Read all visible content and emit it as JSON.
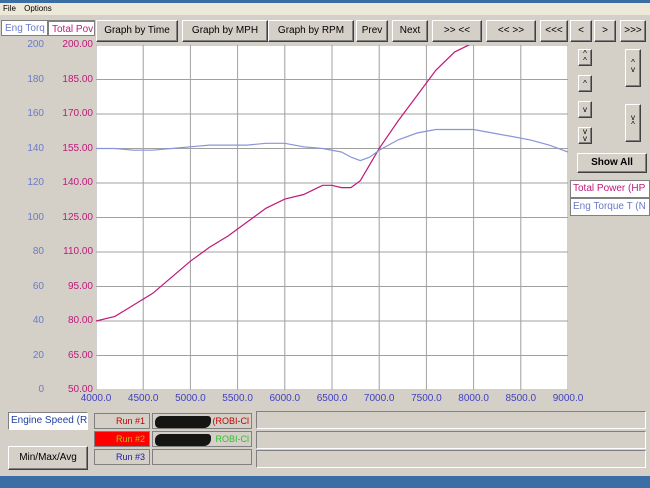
{
  "menu": {
    "file": "File",
    "options": "Options"
  },
  "axis_tabs": {
    "left": "Eng Torq",
    "right": "Total Pov"
  },
  "nav_buttons": [
    {
      "name": "graph-by-time-button",
      "label": "Graph by Time"
    },
    {
      "name": "graph-by-mph-button",
      "label": "Graph by MPH"
    },
    {
      "name": "graph-by-rpm-button",
      "label": "Graph by RPM"
    },
    {
      "name": "prev-button",
      "label": "Prev"
    },
    {
      "name": "next-button",
      "label": "Next"
    },
    {
      "name": "zoom-in-button",
      "label": ">> <<"
    },
    {
      "name": "zoom-out-button",
      "label": "<< >>"
    },
    {
      "name": "scroll-far-left-button",
      "label": "<<<"
    },
    {
      "name": "scroll-left-button",
      "label": "<"
    },
    {
      "name": "scroll-right-button",
      "label": ">"
    },
    {
      "name": "scroll-far-right-button",
      "label": ">>>"
    }
  ],
  "show_all_label": "Show All",
  "legend": [
    {
      "label": "Total Power (HP",
      "color": "#c0187a"
    },
    {
      "label": "Eng Torque T (N",
      "color": "#6a7ac8"
    }
  ],
  "bottom": {
    "x_channel": "Engine Speed (Ri",
    "min_max_avg": "Min/Max/Avg",
    "runs": [
      {
        "label": "Run #1",
        "name": "(ROBI-Cl",
        "label_color": "#c00000",
        "name_color": "#c00000",
        "bg": "#d4d0c8"
      },
      {
        "label": "Run #2",
        "name": "ROBI-Cl",
        "label_color": "#c0c000",
        "name_color": "#30c030",
        "bg": "#ff0000"
      },
      {
        "label": "Run #3",
        "name": "",
        "label_color": "#2020a0",
        "name_color": "#2020a0",
        "bg": "#d4d0c8"
      }
    ]
  },
  "chart_data": {
    "type": "line",
    "x_ticks": [
      "4000.0",
      "4500.0",
      "5000.0",
      "5500.0",
      "6000.0",
      "6500.0",
      "7000.0",
      "7500.0",
      "8000.0",
      "8500.0",
      "9000.0"
    ],
    "xlim": [
      4000,
      9000
    ],
    "y_left_ticks": [
      "200",
      "180",
      "160",
      "140",
      "120",
      "100",
      "80",
      "60",
      "40",
      "20",
      "0"
    ],
    "y_right_ticks": [
      "200.00",
      "185.00",
      "170.00",
      "155.00",
      "140.00",
      "125.00",
      "110.00",
      "95.00",
      "80.00",
      "65.00",
      "50.00"
    ],
    "ylim_left": [
      0,
      200
    ],
    "ylim_right": [
      50,
      200
    ],
    "grid": true,
    "series": [
      {
        "name": "Total Power (HP",
        "axis": "right",
        "color": "#c0187a",
        "x": [
          4000,
          4200,
          4400,
          4600,
          4800,
          5000,
          5200,
          5400,
          5600,
          5800,
          6000,
          6200,
          6300,
          6400,
          6500,
          6600,
          6700,
          6800,
          6900,
          7000,
          7200,
          7400,
          7600,
          7800,
          8000,
          8200,
          8400,
          8600,
          8800,
          9000
        ],
        "y": [
          80,
          82,
          87,
          92,
          99,
          106,
          112,
          117,
          123,
          129,
          133,
          135,
          137,
          139,
          139,
          138,
          138,
          141,
          148,
          155,
          167,
          178,
          189,
          197,
          201,
          203,
          205,
          206,
          206,
          205
        ]
      },
      {
        "name": "Eng Torque T (N",
        "axis": "left",
        "color": "#8a94d8",
        "x": [
          4000,
          4200,
          4400,
          4600,
          4800,
          5000,
          5200,
          5400,
          5600,
          5800,
          6000,
          6200,
          6400,
          6600,
          6700,
          6800,
          6900,
          7000,
          7200,
          7400,
          7600,
          7800,
          8000,
          8200,
          8400,
          8600,
          8800,
          9000
        ],
        "y": [
          140,
          140,
          139,
          139,
          140,
          141,
          142,
          142,
          142,
          143,
          143,
          141,
          140,
          138,
          135,
          133,
          135,
          139,
          145,
          149,
          151,
          151,
          151,
          149,
          147,
          145,
          142,
          138
        ]
      }
    ]
  }
}
